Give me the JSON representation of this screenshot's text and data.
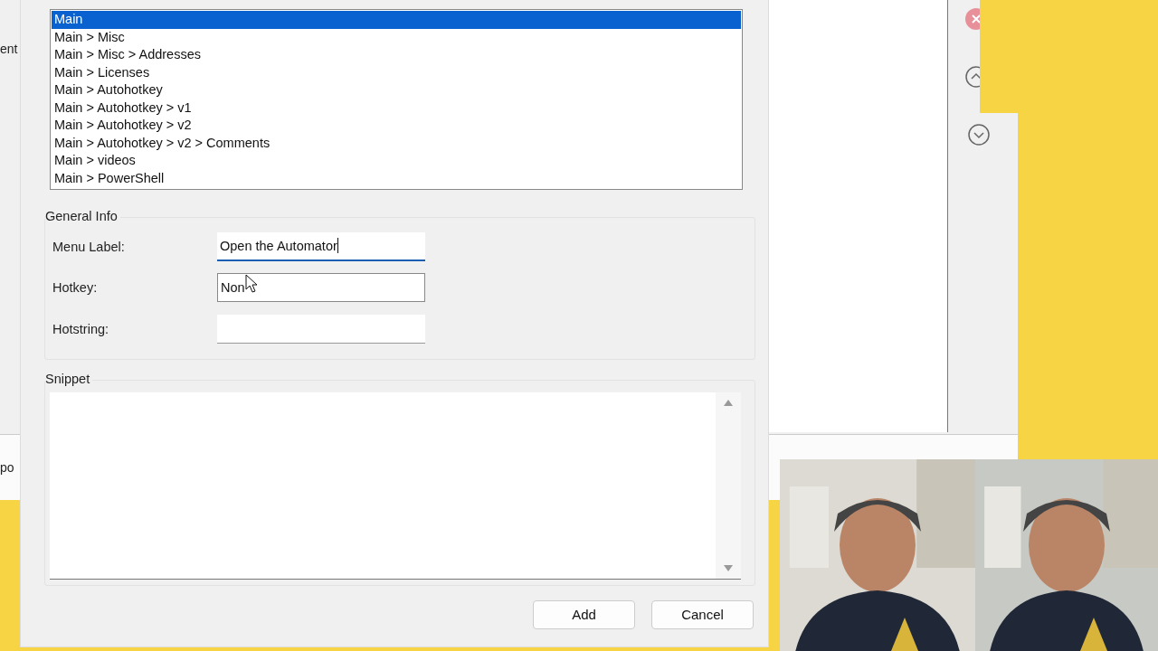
{
  "background_window": {
    "fragments": [
      "ent",
      "po"
    ]
  },
  "parent_list": {
    "items": [
      {
        "label": "Main",
        "selected": true
      },
      {
        "label": "Main > Misc",
        "selected": false
      },
      {
        "label": "Main > Misc > Addresses",
        "selected": false
      },
      {
        "label": "Main > Licenses",
        "selected": false
      },
      {
        "label": "Main > Autohotkey",
        "selected": false
      },
      {
        "label": "Main > Autohotkey > v1",
        "selected": false
      },
      {
        "label": "Main > Autohotkey > v2",
        "selected": false
      },
      {
        "label": "Main > Autohotkey > v2 > Comments",
        "selected": false
      },
      {
        "label": "Main > videos",
        "selected": false
      },
      {
        "label": "Main > PowerShell",
        "selected": false
      }
    ]
  },
  "general_info": {
    "title": "General Info",
    "fields": [
      {
        "label": "Menu Label:",
        "value": "Open the Automator",
        "focused": true
      },
      {
        "label": "Hotkey:",
        "value": "Non",
        "focused": false,
        "kind": "hotkey"
      },
      {
        "label": "Hotstring:",
        "focused": false
      }
    ]
  },
  "snippet": {
    "title": "Snippet"
  },
  "buttons": [
    "Add",
    "Cancel"
  ]
}
